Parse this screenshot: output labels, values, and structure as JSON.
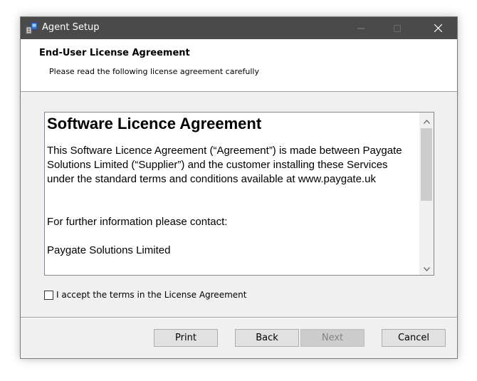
{
  "window": {
    "title": "Agent Setup"
  },
  "header": {
    "title": "End-User License Agreement",
    "subtitle": "Please read the following license agreement carefully"
  },
  "license": {
    "heading": "Software Licence Agreement",
    "paragraph1": "This Software Licence Agreement (“Agreement”) is made between Paygate Solutions Limited (“Supplier”) and the customer installing these Services under the standard terms and conditions available at www.paygate.uk",
    "paragraph2": "For further information please contact:",
    "paragraph3": "Paygate Solutions Limited"
  },
  "accept": {
    "label": "I accept the terms in the License Agreement",
    "checked": false
  },
  "buttons": {
    "print": "Print",
    "back": "Back",
    "next": "Next",
    "cancel": "Cancel"
  },
  "icons": {
    "app": "setup-icon",
    "minimize": "minimize-icon",
    "maximize": "maximize-icon",
    "close": "close-icon",
    "scroll_up": "chevron-up-icon",
    "scroll_down": "chevron-down-icon"
  },
  "colors": {
    "titlebar": "#4a4a4a",
    "dialog_bg": "#f0f0f0",
    "disabled_text": "#838383"
  }
}
